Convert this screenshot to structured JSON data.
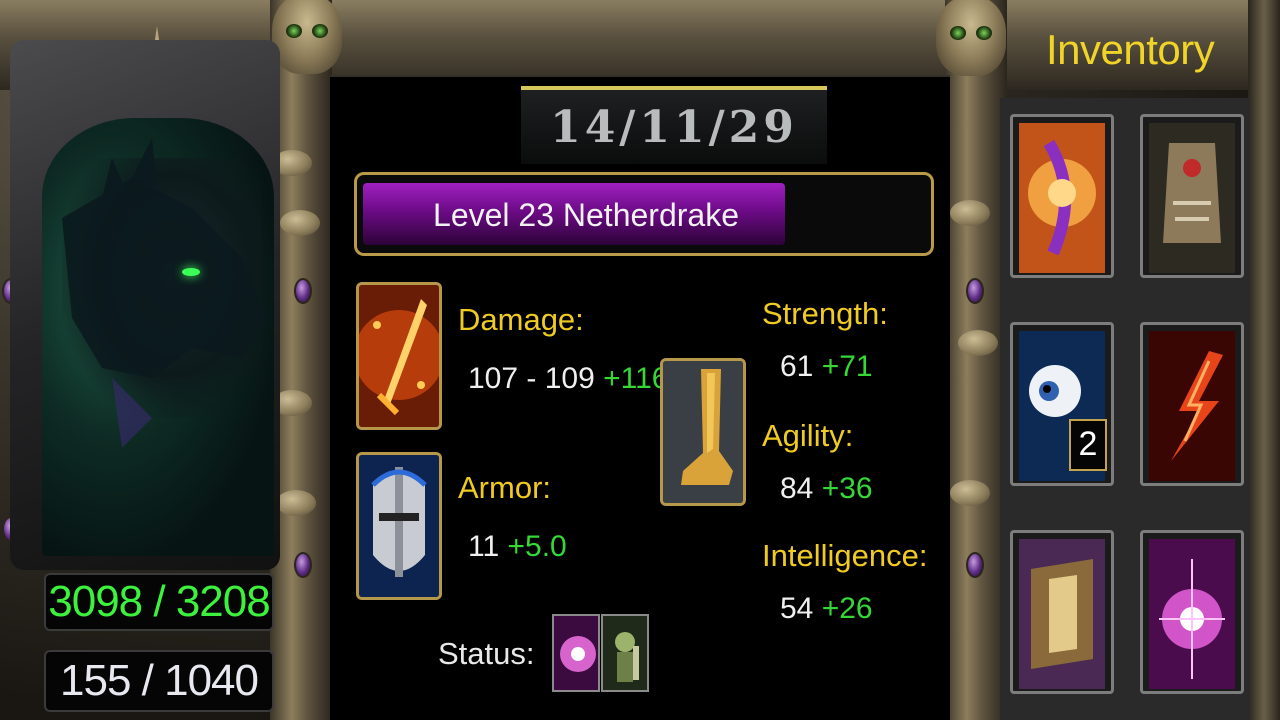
{
  "hero": {
    "kda": "14/11/29",
    "level_text": "Level 23 Netherdrake",
    "level_progress": 0.75,
    "hp": "3098 / 3208",
    "mana": "155 / 1040"
  },
  "stats": {
    "damage": {
      "label": "Damage:",
      "base": "107 - 109",
      "bonus": "+116",
      "icon": "flaming-sword-icon"
    },
    "armor": {
      "label": "Armor:",
      "base": "11",
      "bonus": "+5.0",
      "icon": "knight-helmet-icon"
    },
    "primary_icon": "golden-leg-icon",
    "strength": {
      "label": "Strength:",
      "base": "61",
      "bonus": "+71"
    },
    "agility": {
      "label": "Agility:",
      "base": "84",
      "bonus": "+36"
    },
    "intelligence": {
      "label": "Intelligence:",
      "base": "54",
      "bonus": "+26"
    }
  },
  "status": {
    "label": "Status:",
    "buffs": [
      "pink-burst-buff-icon",
      "goblin-buff-icon"
    ]
  },
  "inventory": {
    "title": "Inventory",
    "items": [
      {
        "name": "purple-orange-orb-item",
        "charges": null
      },
      {
        "name": "bone-armor-item",
        "charges": null
      },
      {
        "name": "eyeball-item",
        "charges": "2"
      },
      {
        "name": "flaming-boots-item",
        "charges": null
      },
      {
        "name": "golden-shield-item",
        "charges": null
      },
      {
        "name": "pink-light-item",
        "charges": null
      }
    ]
  }
}
